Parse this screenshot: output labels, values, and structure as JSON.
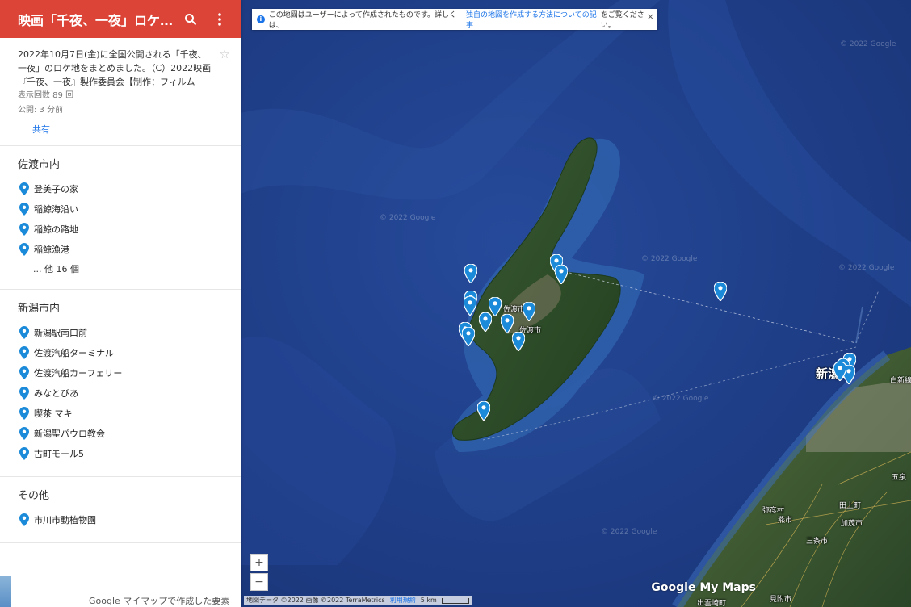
{
  "header": {
    "title": "映画「千夜、一夜」ロケ地マップ",
    "icons": [
      "search-icon",
      "more-vert-icon"
    ]
  },
  "info": {
    "description": "2022年10月7日(金)に全国公開される「千夜、一夜」のロケ地をまとめました。（C）2022映画『千夜、一夜』製作委員会【制作：フィルム",
    "views": "表示回数 89 回",
    "published": "公開: 3 分前",
    "share_label": "共有"
  },
  "sections": [
    {
      "title": "佐渡市内",
      "items": [
        "登美子の家",
        "稲鯨海沿い",
        "稲鯨の路地",
        "稲鯨漁港"
      ],
      "more": "... 他 16 個"
    },
    {
      "title": "新潟市内",
      "items": [
        "新潟駅南口前",
        "佐渡汽船ターミナル",
        "佐渡汽船カーフェリー",
        "みなとぴあ",
        "喫茶 マキ",
        "新潟聖パウロ教会",
        "古町モール5"
      ],
      "more": ""
    },
    {
      "title": "その他",
      "items": [
        "市川市動植物園"
      ],
      "more": ""
    }
  ],
  "footer": "Google マイマップで作成した要素",
  "map": {
    "infobar_text": "この地図はユーザーによって作成されたものです。詳しくは、",
    "infobar_link": "独自の地図を作成する方法についての記事",
    "infobar_tail": "をご覧ください。",
    "close": "×",
    "zoom_in": "+",
    "zoom_out": "−",
    "attribution": "地図データ ©2022 画像 ©2022 TerraMetrics",
    "terms": "利用規約",
    "scale": "5 km",
    "logo": "Google My Maps",
    "watermark": "© 2022 Google",
    "labels": {
      "sado_area": "佐渡市",
      "sado_city": "佐渡市",
      "niigata": "新潟",
      "shirone": "白新線",
      "gosen": "五泉",
      "tagami": "田上町",
      "kamo": "加茂市",
      "yahiko": "弥彦村",
      "sanjo": "三条市",
      "tsubame": "燕市",
      "izumozaki": "出雲崎町",
      "mitsuke": "見附市"
    },
    "colors": {
      "sea": "#1e3d86",
      "land": "#2c4a2a",
      "marker": "#1a8ad9",
      "header": "#db4437"
    }
  }
}
